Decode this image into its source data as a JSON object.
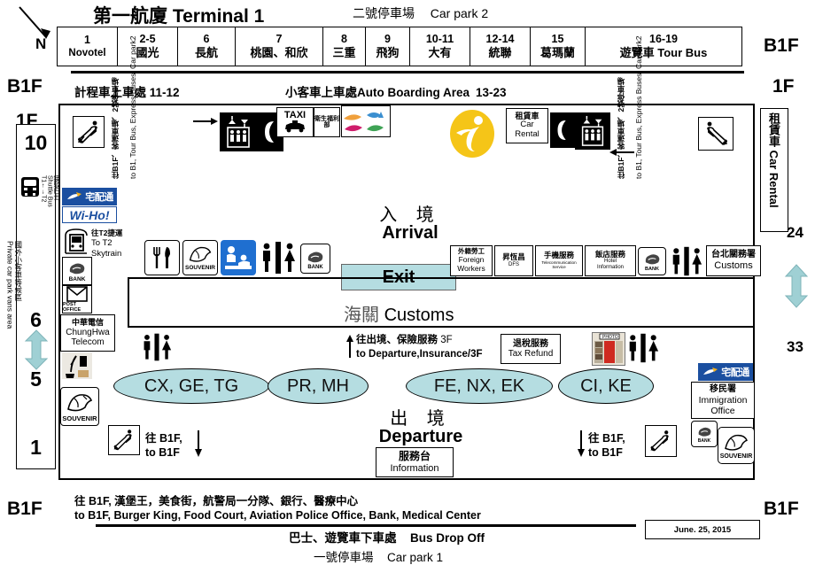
{
  "header": {
    "title_cn": "第一航廈",
    "title_en": "Terminal 1",
    "title_full": "第一航廈 Terminal 1",
    "carpark2_cn": "二號停車場",
    "carpark2_en": "Car park 2",
    "north_label": "N"
  },
  "gates": [
    {
      "num": "1",
      "name": "Novotel"
    },
    {
      "num": "2-5",
      "name": "國光"
    },
    {
      "num": "6",
      "name": "長航"
    },
    {
      "num": "7",
      "name": "桃園、和欣"
    },
    {
      "num": "8",
      "name": "三重"
    },
    {
      "num": "9",
      "name": "飛狗"
    },
    {
      "num": "10-11",
      "name": "大有"
    },
    {
      "num": "12-14",
      "name": "統聯"
    },
    {
      "num": "15",
      "name": "葛瑪蘭"
    },
    {
      "num": "16-19",
      "name": "遊覽車 Tour Bus"
    }
  ],
  "floor_labels": {
    "top_right_b1f": "B1F",
    "top_right_1f": "1F",
    "left_b1f": "B1F",
    "left_1f": "1F",
    "bottom_left_b1f": "B1F",
    "bottom_right_b1f": "B1F"
  },
  "pickup": {
    "taxi_cn": "計程車上車處",
    "taxi_num": "11-12",
    "auto_cn": "小客車上車處",
    "auto_en": "Auto Boarding Area",
    "auto_num": "13-23"
  },
  "left_column": {
    "numbers": [
      "10",
      "6",
      "5",
      "1"
    ],
    "shuttle_cn": "接駁巴士",
    "shuttle_en": "Shuttle Bus",
    "shuttle_route": "T1←→T2",
    "private_cn": "國外小客車等候區",
    "private_en": "Private car park vans area"
  },
  "right_column": {
    "car_rental_cn": "租賃車",
    "car_rental_en": "Car Rental",
    "bay_24": "24",
    "bay_33": "33"
  },
  "left_services": [
    {
      "id": "tcat",
      "cn": "宅配通",
      "en": "T-CAT"
    },
    {
      "id": "wiho",
      "cn": "",
      "en": "Wi-Ho!"
    },
    {
      "id": "skytrain",
      "cn": "往T2捷運",
      "en": "To T2 Skytrain"
    },
    {
      "id": "bank",
      "cn": "",
      "en": "BANK"
    },
    {
      "id": "post",
      "cn": "",
      "en": "POST OFFICE"
    },
    {
      "id": "telecom",
      "cn": "中華電信",
      "en": "ChungHwa Telecom"
    }
  ],
  "top_icons": {
    "escalator_left": "escalator-down",
    "to_b1_cn": "往B1F、客運車場、2號停車場",
    "to_b1_en": "to B1, Tour Bus, Express Buses, Car park2",
    "elevator": "elevator",
    "phone": "telephone",
    "taxi": "TAXI",
    "health_cn": "衛生福利部",
    "tourism_logo": "tourism-logo",
    "info_logo": "taiwan-tourism-i",
    "car_rental_cn": "租賃車",
    "car_rental_en": "Car Rental",
    "escalator_right": "escalator-down"
  },
  "arrival": {
    "cn": "入 境",
    "en": "Arrival",
    "exit_label": "Exit",
    "customs_cn": "海關",
    "customs_en": "Customs",
    "icons": [
      "restaurant",
      "souvenir",
      "baby-care",
      "restroom",
      "bank"
    ],
    "service_boxes": [
      {
        "cn": "外籍勞工",
        "en": "Foreign Workers"
      },
      {
        "cn": "昇恆昌",
        "en": "DFS"
      },
      {
        "cn": "手機服務",
        "en": "Telecommunication Service"
      },
      {
        "cn": "飯店服務",
        "en": "Hotel Information"
      },
      {
        "cn": "",
        "en": "BANK"
      },
      {
        "cn": "",
        "en": "restroom"
      },
      {
        "cn": "台北關務署",
        "en": "Customs"
      }
    ]
  },
  "departure": {
    "cn": "出 境",
    "en": "Departure",
    "to_departure_cn": "往出境、保險服務",
    "to_departure_floor": "3F",
    "to_departure_en": "to Departure,Insurance/3F",
    "tax_refund_cn": "退稅服務",
    "tax_refund_en": "Tax Refund",
    "photo_label": "PHOTO",
    "information_cn": "服務台",
    "information_en": "Information",
    "immigration_cn": "移民署",
    "immigration_en": "Immigration Office",
    "to_b1f_left_cn": "往 B1F,",
    "to_b1f_left_en": "to B1F",
    "to_b1f_right_cn": "往 B1F,",
    "to_b1f_right_en": "to B1F",
    "airline_groups": [
      "CX, GE, TG",
      "PR, MH",
      "FE, NX, EK",
      "CI, KE"
    ]
  },
  "footer": {
    "line1_cn": "往 B1F, 漢堡王，美食街，航警局一分隊、銀行、醫療中心",
    "line1_en": "to B1F, Burger King, Food Court, Aviation Police Office, Bank, Medical Center",
    "busdrop_cn": "巴士、遊覽車下車處",
    "busdrop_en": "Bus Drop Off",
    "carpark1_cn": "一號停車場",
    "carpark1_en": "Car park 1",
    "date": "June. 25, 2015"
  },
  "colors": {
    "teal": "#b5dde1",
    "teal_arrow": "#9fd0d4",
    "blue_logo": "#1b4fa0",
    "yellow": "#f5c518",
    "baby_blue": "#1f6fd0"
  }
}
